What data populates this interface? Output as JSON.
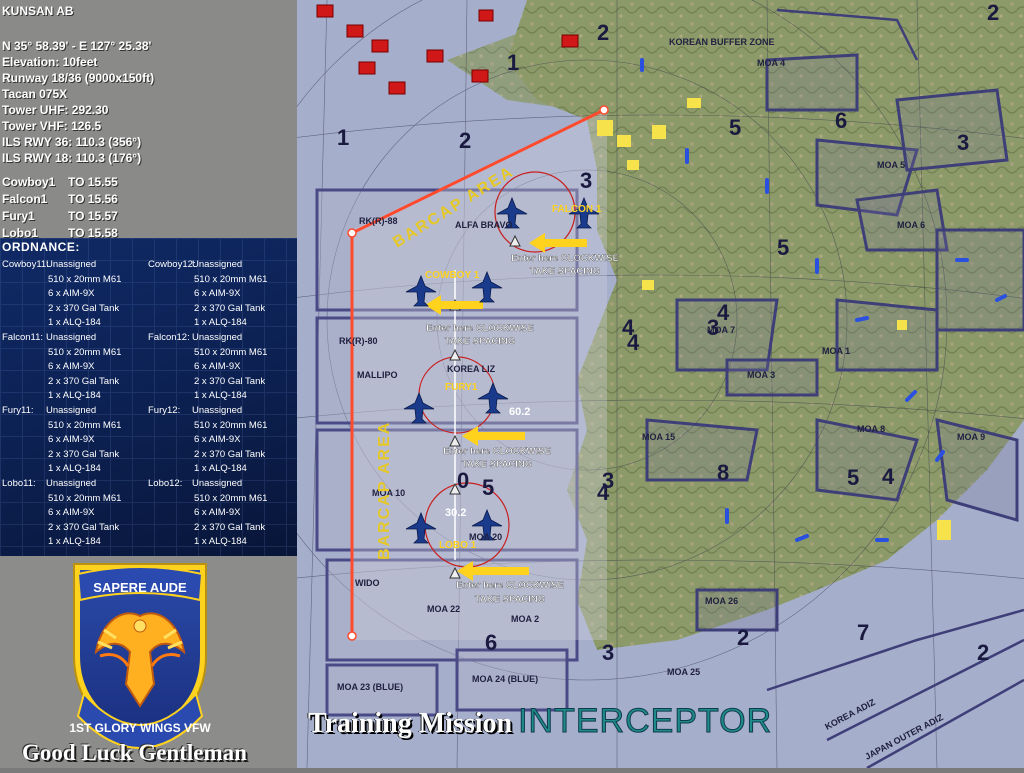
{
  "airbase": {
    "name": "KUNSAN AB",
    "coords": "N 35° 58.39' - E 127° 25.38'",
    "elevation": "Elevation: 10feet",
    "runway": "Runway 18/36 (9000x150ft)",
    "tacan": "Tacan 075X",
    "tower_uhf": "Tower UHF: 292.30",
    "tower_vhf": "Tower VHF: 126.5",
    "ils36": "ILS RWY 36: 110.3 (356°)",
    "ils18": "ILS RWY 18: 110.3 (176°)"
  },
  "flights": [
    {
      "name": "Cowboy1",
      "to": "TO 15.55"
    },
    {
      "name": "Falcon1",
      "to": "TO 15.56"
    },
    {
      "name": "Fury1",
      "to": "TO 15.57"
    },
    {
      "name": "Lobo1",
      "to": "TO 15.58"
    }
  ],
  "ordnance": {
    "title": "ORDNANCE:",
    "aircraft": [
      {
        "name": "Cowboy11:",
        "loadout": [
          "Unassigned",
          "510 x 20mm M61",
          "6 x AIM-9X",
          "2 x 370 Gal Tank",
          "1 x ALQ-184"
        ]
      },
      {
        "name": "Cowboy12:",
        "loadout": [
          "Unassigned",
          "510 x 20mm M61",
          "6 x AIM-9X",
          "2 x 370 Gal Tank",
          "1 x ALQ-184"
        ]
      },
      {
        "name": "Falcon11:",
        "loadout": [
          "Unassigned",
          "510 x 20mm M61",
          "6 x AIM-9X",
          "2 x 370 Gal Tank",
          "1 x ALQ-184"
        ]
      },
      {
        "name": "Falcon12:",
        "loadout": [
          "Unassigned",
          "510 x 20mm M61",
          "6 x AIM-9X",
          "2 x 370 Gal Tank",
          "1 x ALQ-184"
        ]
      },
      {
        "name": "Fury11:",
        "loadout": [
          "Unassigned",
          "510 x 20mm M61",
          "6 x AIM-9X",
          "2 x 370 Gal Tank",
          "1 x ALQ-184"
        ]
      },
      {
        "name": "Fury12:",
        "loadout": [
          "Unassigned",
          "510 x 20mm M61",
          "6 x AIM-9X",
          "2 x 370 Gal Tank",
          "1 x ALQ-184"
        ]
      },
      {
        "name": "Lobo11:",
        "loadout": [
          "Unassigned",
          "510 x 20mm M61",
          "6 x AIM-9X",
          "2 x 370 Gal Tank",
          "1 x ALQ-184"
        ]
      },
      {
        "name": "Lobo12:",
        "loadout": [
          "Unassigned",
          "510 x 20mm M61",
          "6 x AIM-9X",
          "2 x 370 Gal Tank",
          "1 x ALQ-184"
        ]
      }
    ]
  },
  "emblem": {
    "motto_top": "SAPERE AUDE",
    "motto_bottom": "1ST GLORY WINGS VFW"
  },
  "footer": {
    "good_luck": "Good Luck Gentleman",
    "mission_label": "Training Mission",
    "mission_name": "INTERCEPTOR"
  },
  "map": {
    "barcap_label": "BARCAP AREA",
    "instruction_line1": "Enter here CLOCKWISE",
    "instruction_line2": "TAKE SPACING",
    "flight_labels": {
      "falcon": "FALCON 1",
      "cowboy": "COWBOY 1",
      "fury": "FURY1",
      "lobo": "LOBO 1"
    },
    "distances": [
      "60.2",
      "30.2"
    ],
    "zone_labels": [
      "KOREAN BUFFER ZONE",
      "ALFA BRAVO",
      "KOREA LIZ",
      "MALLIPO",
      "WIDO",
      "RK(R)-80",
      "RK(R)-88",
      "MOA 10",
      "MOA 20",
      "MOA 22",
      "MOA 23 (BLUE)",
      "MOA 24 (BLUE)",
      "MOA 25",
      "MOA 26",
      "MOA 15",
      "MOA 3",
      "MOA 1",
      "MOA 2",
      "MOA 4",
      "MOA 5",
      "MOA 6",
      "MOA 7",
      "MOA 8",
      "MOA 9",
      "KOREA ADIZ",
      "JAPAN OUTER ADIZ"
    ],
    "grid_labels": [
      "1",
      "2",
      "3",
      "4",
      "5",
      "6",
      "1",
      "2",
      "3",
      "4",
      "5",
      "6",
      "2",
      "3",
      "4",
      "5",
      "0",
      "2",
      "3",
      "3",
      "4",
      "5",
      "7",
      "2",
      "8",
      "4"
    ],
    "colors": {
      "route": "#ff4a2e",
      "arrow": "#ffd21e",
      "land": "#8a9a6e",
      "sea": "#a7b0cc",
      "airspace": "#4a4a86"
    }
  }
}
